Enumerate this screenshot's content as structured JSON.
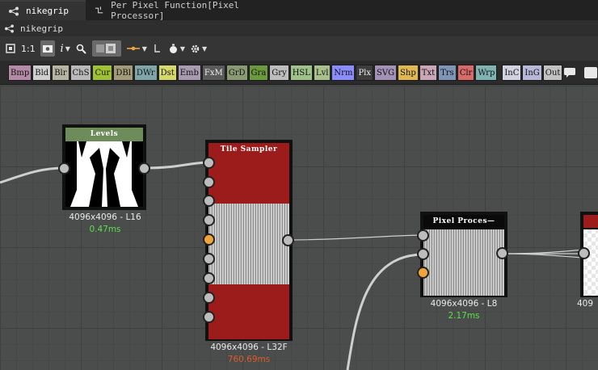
{
  "tabs": [
    {
      "label": "nikegrip",
      "icon": "graph-icon",
      "active": true
    },
    {
      "label": "Per Pixel Function[Pixel Processor]",
      "icon": "function-icon",
      "active": false
    }
  ],
  "breadcrumb": {
    "label": "nikegrip",
    "icon": "graph-icon"
  },
  "toolbar": {
    "items": [
      "fit-view-icon",
      "1:1",
      "screenshot-icon",
      "info-icon",
      "search-icon",
      "layout-icon",
      "connector-icon",
      "pin-icon",
      "timer-icon",
      "settings-icon"
    ],
    "one_to_one": "1:1",
    "info": "i"
  },
  "palette": {
    "buttons": [
      {
        "label": "Bmp",
        "color": "#b58aa6"
      },
      {
        "label": "Bld",
        "color": "#cfcfcf"
      },
      {
        "label": "Blr",
        "color": "#b4b4a0"
      },
      {
        "label": "ChS",
        "color": "#b9b9b9"
      },
      {
        "label": "Cur",
        "color": "#9ec233"
      },
      {
        "label": "DBl",
        "color": "#a39b78"
      },
      {
        "label": "DWr",
        "color": "#7fa6a9"
      },
      {
        "label": "Dst",
        "color": "#d6d96a"
      },
      {
        "label": "Emb",
        "color": "#a89ab0"
      },
      {
        "label": "FxM",
        "color": "#5a5a5a"
      },
      {
        "label": "GrD",
        "color": "#8a9a74"
      },
      {
        "label": "Gra",
        "color": "#6b9a3d"
      },
      {
        "label": "Gry",
        "color": "#bdbdbd"
      },
      {
        "label": "HSL",
        "color": "#9ec28a"
      },
      {
        "label": "Lvl",
        "color": "#a8c08c"
      },
      {
        "label": "Nrm",
        "color": "#8a8cff"
      },
      {
        "label": "Plx",
        "color": "#3d3d3d"
      },
      {
        "label": "SVG",
        "color": "#a391b8"
      },
      {
        "label": "Shp",
        "color": "#e0b84f"
      },
      {
        "label": "Txt",
        "color": "#c9a7b6"
      },
      {
        "label": "Trs",
        "color": "#7f95b8"
      },
      {
        "label": "Clr",
        "color": "#d86a6a"
      },
      {
        "label": "Wrp",
        "color": "#7fb3b3"
      },
      {
        "label": "InC",
        "color": "#d1d1e0"
      },
      {
        "label": "InG",
        "color": "#b7b7d9"
      },
      {
        "label": "Out",
        "color": "#c2c2c2"
      }
    ],
    "right_icons": [
      "comment-icon",
      "frame-icon",
      "pin-icon"
    ]
  },
  "nodes": {
    "levels": {
      "title": "Levels",
      "title_color": "#6e8c5a",
      "resolution": "4096x4096 - L16",
      "time": "0.47ms",
      "time_color": "#59e04a"
    },
    "tile_sampler": {
      "title": "Tile Sampler",
      "title_color": "#9c1b1b",
      "resolution": "4096x4096 - L32F",
      "time": "760.69ms",
      "time_color": "#e05a2a",
      "inputs": 8
    },
    "pixel_processor": {
      "title": "Pixel Proces—",
      "title_color": "#0a0a0a",
      "resolution": "4096x4096 - L8",
      "time": "2.17ms",
      "time_color": "#59e04a",
      "inputs": 3
    },
    "partial": {
      "resolution": "409",
      "title_color": "#9c1b1b"
    }
  }
}
